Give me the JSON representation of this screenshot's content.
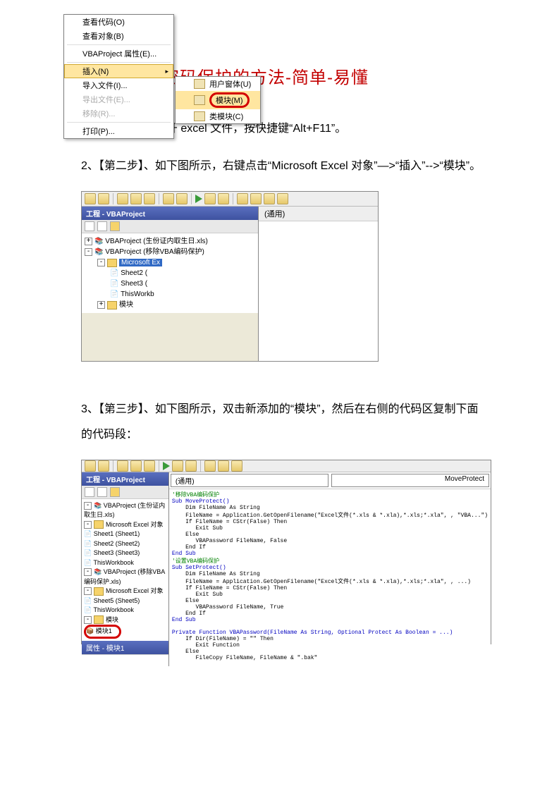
{
  "title": "破解 VBA 密码保护的方法-简单-易懂",
  "p1": "1、【第一步】、打开 excel 文件，按快捷键“Alt+F11”。",
  "p2": "2、【第二步】、如下图所示，右键点击“Microsoft Excel 对象”—>“插入”-->“模块”。",
  "p3": "3、【第三步】、如下图所示，双击新添加的“模块”，然后在右侧的代码区复制下面的代码段：",
  "shot1": {
    "projtitle": "工程 - VBAProject",
    "tree": {
      "l1": "VBAProject (生份证内取生日.xls)",
      "l2": "VBAProject (移除VBA编码保护)",
      "hl": "Microsoft Ex",
      "s1": "Sheet2 (",
      "s2": "Sheet3 (",
      "s3": "ThisWorkb",
      "mod": "模块"
    },
    "context": {
      "m1": "查看代码(O)",
      "m2": "查看对象(B)",
      "m3": "VBAProject 属性(E)...",
      "m4": "插入(N)",
      "m5": "导入文件(I)...",
      "m6": "导出文件(E)...",
      "m7": "移除(R)...",
      "m8": "打印(P)..."
    },
    "flyout": {
      "f1": "用户窗体(U)",
      "f2": "模块(M)",
      "f3": "类模块(C)"
    },
    "right_dropdown": "(通用)"
  },
  "shot2": {
    "projtitle": "工程 - VBAProject",
    "tree": {
      "l1": "VBAProject (生份证内取生日.xls)",
      "g1": "Microsoft Excel 对象",
      "s1": "Sheet1 (Sheet1)",
      "s2": "Sheet2 (Sheet2)",
      "s3": "Sheet3 (Sheet3)",
      "s4": "ThisWorkbook",
      "l2": "VBAProject (移除VBA编码保护.xls)",
      "g2": "Microsoft Excel 对象",
      "s5": "Sheet5 (Sheet5)",
      "s6": "ThisWorkbook",
      "modg": "模块",
      "mod1": "模块1"
    },
    "bottom": "属性 - 模块1",
    "right_dropdown_l": "(通用)",
    "right_dropdown_r": "MoveProtect",
    "code_comment1": "'移除VBA编码保护",
    "code_l1": "Sub MoveProtect()",
    "code_l2": "    Dim FileName As String",
    "code_l3": "    FileName = Application.GetOpenFilename(\"Excel文件(*.xls & *.xla),*.xls;*.xla\", , \"VBA...\")",
    "code_l4": "    If FileName = CStr(False) Then",
    "code_l5": "       Exit Sub",
    "code_l6": "    Else",
    "code_l7": "       VBAPassword FileName, False",
    "code_l8": "    End If",
    "code_l9": "End Sub",
    "code_comment2": "'设置VBA编码保护",
    "code_l10": "Sub SetProtect()",
    "code_l11": "    Dim FileName As String",
    "code_l12": "    FileName = Application.GetOpenFilename(\"Excel文件(*.xls & *.xla),*.xls;*.xla\", , ...)",
    "code_l13": "    If FileName = CStr(False) Then",
    "code_l14": "       Exit Sub",
    "code_l15": "    Else",
    "code_l16": "       VBAPassword FileName, True",
    "code_l17": "    End If",
    "code_l18": "End Sub",
    "code_l19": "Private Function VBAPassword(FileName As String, Optional Protect As Boolean = ...)",
    "code_l20": "    If Dir(FileName) = \"\" Then",
    "code_l21": "       Exit Function",
    "code_l22": "    Else",
    "code_l23": "       FileCopy FileName, FileName & \".bak\""
  }
}
